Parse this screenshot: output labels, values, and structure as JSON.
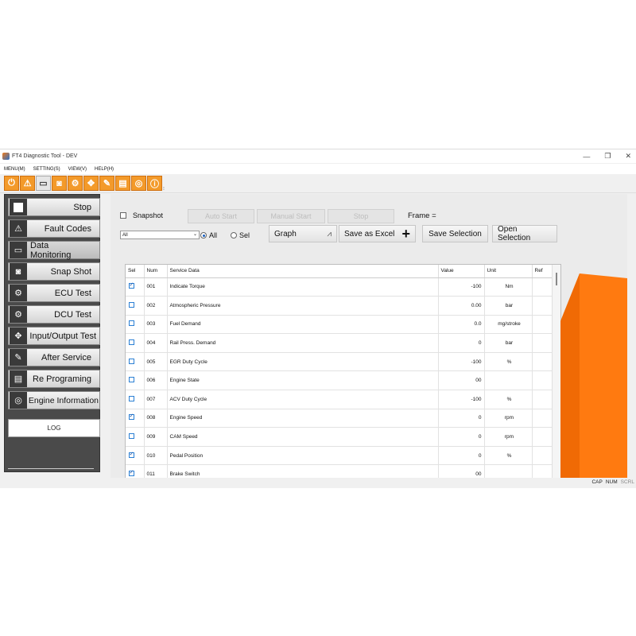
{
  "window": {
    "title": "FT4 Diagnostic Tool - DEV"
  },
  "menubar": {
    "items": [
      "MENU(M)",
      "SETTING(S)",
      "VIEW(V)",
      "HELP(H)"
    ]
  },
  "toolbar": {
    "buttons": [
      "power-icon",
      "warning-icon",
      "monitor-icon",
      "camera-icon",
      "ecu-icon",
      "io-icon",
      "service-icon",
      "reprogram-icon",
      "engine-info-icon",
      "info-icon"
    ]
  },
  "sidebar": {
    "items": [
      {
        "label": "Stop",
        "icon": "stop-icon"
      },
      {
        "label": "Fault Codes",
        "icon": "warning-icon"
      },
      {
        "label": "Data Monitoring",
        "icon": "monitor-icon"
      },
      {
        "label": "Snap Shot",
        "icon": "camera-icon"
      },
      {
        "label": "ECU Test",
        "icon": "gears-icon"
      },
      {
        "label": "DCU Test",
        "icon": "gears-icon"
      },
      {
        "label": "Input/Output Test",
        "icon": "arrows-icon"
      },
      {
        "label": "After Service",
        "icon": "wrench-icon"
      },
      {
        "label": "Re Programing",
        "icon": "chip-icon"
      },
      {
        "label": "Engine Information",
        "icon": "ecu-icon"
      }
    ],
    "log_label": "LOG"
  },
  "controls": {
    "snapshot_label": "Snapshot",
    "auto_start": "Auto Start",
    "manual_start": "Manual Start",
    "stop": "Stop",
    "frame_label": "Frame =",
    "filter_value": "All",
    "radio_all": "All",
    "radio_sel": "Sel",
    "graph": "Graph",
    "save_excel": "Save as Excel",
    "save_selection": "Save Selection",
    "open_selection": "Open Selection"
  },
  "table": {
    "headers": [
      "Sel",
      "Num",
      "Service Data",
      "Value",
      "Unit",
      "Ref"
    ],
    "rows": [
      {
        "sel": true,
        "num": "001",
        "name": "Indicate Torque",
        "value": "-100",
        "unit": "Nm"
      },
      {
        "sel": false,
        "num": "002",
        "name": "Atmospheric Pressure",
        "value": "0.00",
        "unit": "bar"
      },
      {
        "sel": false,
        "num": "003",
        "name": "Fuel Demand",
        "value": "0.0",
        "unit": "mg/stroke"
      },
      {
        "sel": false,
        "num": "004",
        "name": "Rail Press. Demand",
        "value": "0",
        "unit": "bar"
      },
      {
        "sel": false,
        "num": "005",
        "name": "EGR Duty Cycle",
        "value": "-100",
        "unit": "%"
      },
      {
        "sel": false,
        "num": "006",
        "name": "Engine State",
        "value": "00",
        "unit": ""
      },
      {
        "sel": false,
        "num": "007",
        "name": "ACV Duty Cycle",
        "value": "-100",
        "unit": "%"
      },
      {
        "sel": true,
        "num": "008",
        "name": "Engine Speed",
        "value": "0",
        "unit": "rpm"
      },
      {
        "sel": false,
        "num": "009",
        "name": "CAM Speed",
        "value": "0",
        "unit": "rpm"
      },
      {
        "sel": true,
        "num": "010",
        "name": "Pedal Position",
        "value": "0",
        "unit": "%"
      },
      {
        "sel": true,
        "num": "011",
        "name": "Brake Switch",
        "value": "00",
        "unit": ""
      }
    ]
  },
  "statusbar": {
    "cap": "CAP",
    "num": "NUM",
    "scrl": "SCRL"
  },
  "colors": {
    "accent": "#f39a2a",
    "orange_panel": "#ff7a10",
    "sidebar_bg": "#4a4a4a"
  }
}
